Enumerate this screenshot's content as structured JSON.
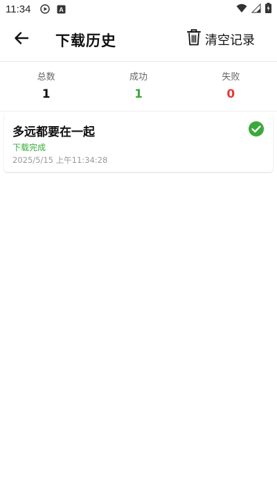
{
  "status_bar": {
    "time": "11:34",
    "icons": [
      "play-circle-icon",
      "a-box-icon",
      "wifi-icon",
      "signal-icon",
      "battery-charging-icon"
    ]
  },
  "app_bar": {
    "title": "下载历史",
    "back_icon": "arrow-left-icon",
    "clear_label": "清空记录",
    "clear_icon": "trash-icon"
  },
  "stats": {
    "total_label": "总数",
    "total_value": "1",
    "success_label": "成功",
    "success_value": "1",
    "failed_label": "失败",
    "failed_value": "0"
  },
  "history": {
    "items": [
      {
        "title": "多远都要在一起",
        "status": "下载完成",
        "time": "2025/5/15 上午11:34:28",
        "status_icon": "check-circle-icon"
      }
    ]
  },
  "colors": {
    "success": "#3aaa3a",
    "failed": "#e53935",
    "text": "#111111",
    "muted": "#999999"
  }
}
